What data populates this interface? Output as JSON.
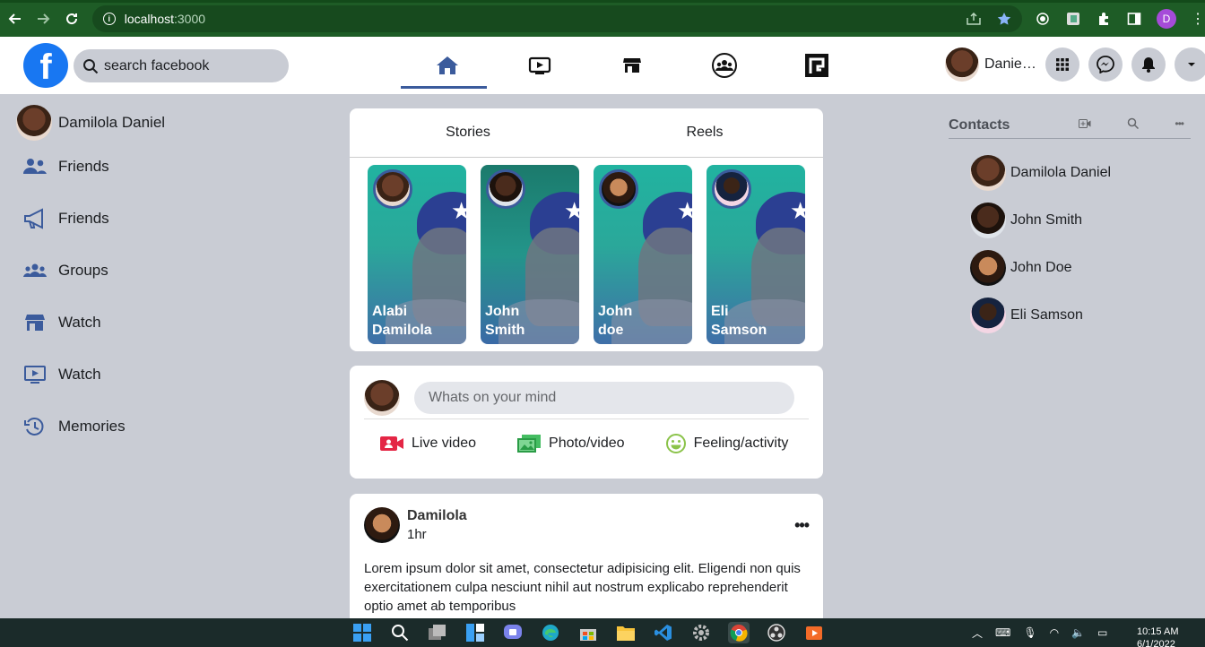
{
  "browser": {
    "url_host": "localhost",
    "url_port": ":3000",
    "profile_initial": "D"
  },
  "header": {
    "logo_letter": "f",
    "search_placeholder": "search facebook",
    "user_name": "Daniel...",
    "nav_tabs": [
      "home",
      "watch",
      "marketplace",
      "groups",
      "gaming"
    ],
    "active_tab": "home"
  },
  "left_sidebar": {
    "profile_name": "Damilola Daniel",
    "items": [
      {
        "label": "Friends",
        "icon": "friends-icon"
      },
      {
        "label": "Friends",
        "icon": "megaphone-icon"
      },
      {
        "label": "Groups",
        "icon": "groups-icon"
      },
      {
        "label": "Watch",
        "icon": "store-icon"
      },
      {
        "label": "Watch",
        "icon": "video-icon"
      },
      {
        "label": "Memories",
        "icon": "clock-icon"
      }
    ]
  },
  "stories": {
    "tabs": [
      "Stories",
      "Reels"
    ],
    "items": [
      {
        "line1": "Alabi",
        "line2": "Damilola"
      },
      {
        "line1": "John",
        "line2": "Smith"
      },
      {
        "line1": "John",
        "line2": "doe"
      },
      {
        "line1": "Eli",
        "line2": "Samson"
      }
    ]
  },
  "compose": {
    "placeholder": "Whats on your mind",
    "actions": [
      {
        "label": "Live video",
        "icon": "live-video-icon",
        "color": "#e42645"
      },
      {
        "label": "Photo/video",
        "icon": "photo-icon",
        "color": "#45bd62"
      },
      {
        "label": "Feeling/activity",
        "icon": "smiley-icon",
        "color": "#8bc34a"
      }
    ]
  },
  "post": {
    "author": "Damilola",
    "time": "1hr",
    "text": "Lorem ipsum dolor sit amet, consectetur adipisicing elit. Eligendi non quis exercitationem culpa nesciunt nihil aut nostrum explicabo reprehenderit optio amet ab temporibus"
  },
  "contacts": {
    "title": "Contacts",
    "items": [
      "Damilola Daniel",
      "John Smith",
      "John Doe",
      "Eli Samson"
    ]
  },
  "taskbar": {
    "time": "10:15 AM",
    "date": "6/1/2022"
  },
  "colors": {
    "brand": "#1877f2",
    "accent": "#3b5b9c",
    "page_bg": "#c9ccd4"
  }
}
